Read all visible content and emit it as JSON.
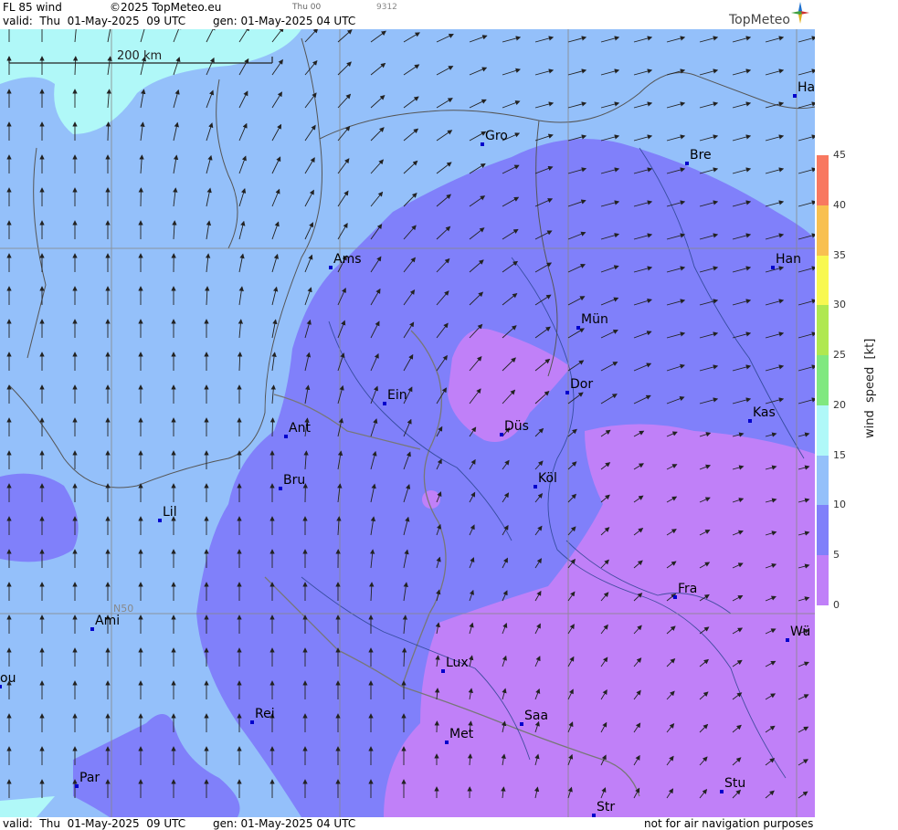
{
  "header": {
    "product": "FL 85 wind",
    "copyright": "©2025 TopMeteo.eu",
    "small_day": "Thu 00",
    "small_code": "9312",
    "valid": "valid:  Thu  01-May-2025  09 UTC",
    "gen": "gen: 01-May-2025 04 UTC"
  },
  "logo": {
    "text": "TopMeteo",
    "icon": "compass-star-icon"
  },
  "scale": {
    "label": "200 km"
  },
  "grid_label": "N50",
  "cities": [
    {
      "name": "Gro"
    },
    {
      "name": "Bre"
    },
    {
      "name": "Ha"
    },
    {
      "name": "Ams"
    },
    {
      "name": "Han"
    },
    {
      "name": "Mün"
    },
    {
      "name": "Dor"
    },
    {
      "name": "Ein"
    },
    {
      "name": "Düs"
    },
    {
      "name": "Kas"
    },
    {
      "name": "Ant"
    },
    {
      "name": "Bru"
    },
    {
      "name": "Köl"
    },
    {
      "name": "Lil"
    },
    {
      "name": "Fra"
    },
    {
      "name": "Ami"
    },
    {
      "name": "Wü"
    },
    {
      "name": "Lux"
    },
    {
      "name": "ou"
    },
    {
      "name": "Rei"
    },
    {
      "name": "Saa"
    },
    {
      "name": "Met"
    },
    {
      "name": "Par"
    },
    {
      "name": "Stu"
    },
    {
      "name": "Str"
    }
  ],
  "legend": {
    "title": "wind  speed  [kt]",
    "ticks": [
      "0",
      "5",
      "10",
      "15",
      "20",
      "25",
      "30",
      "35",
      "40",
      "45"
    ],
    "colors": {
      "0-5": "#c080f8",
      "5-10": "#8080fa",
      "10-15": "#94c0fa",
      "15-20": "#b0f8f8",
      "20-25": "#80e880",
      "25-30": "#b0e850",
      "30-35": "#f8f850",
      "35-40": "#f8c050",
      "40-45": "#f87860"
    }
  },
  "footer": {
    "valid": "valid:  Thu  01-May-2025  09 UTC",
    "gen": "gen: 01-May-2025 04 UTC",
    "disclaimer": "not for air navigation purposes"
  }
}
